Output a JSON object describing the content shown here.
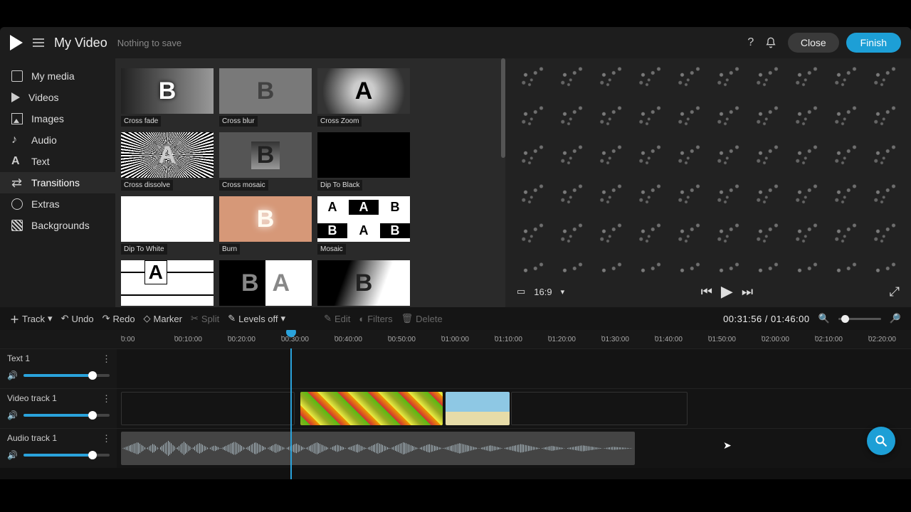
{
  "header": {
    "title": "My Video",
    "save_status": "Nothing to save",
    "close": "Close",
    "finish": "Finish"
  },
  "sidebar": {
    "items": [
      {
        "label": "My media"
      },
      {
        "label": "Videos"
      },
      {
        "label": "Images"
      },
      {
        "label": "Audio"
      },
      {
        "label": "Text"
      },
      {
        "label": "Transitions"
      },
      {
        "label": "Extras"
      },
      {
        "label": "Backgrounds"
      }
    ],
    "active_index": 5
  },
  "transitions": [
    {
      "label": "Cross fade"
    },
    {
      "label": "Cross blur"
    },
    {
      "label": "Cross Zoom"
    },
    {
      "label": "Cross dissolve"
    },
    {
      "label": "Cross mosaic"
    },
    {
      "label": "Dip To Black"
    },
    {
      "label": "Dip To White"
    },
    {
      "label": "Burn"
    },
    {
      "label": "Mosaic"
    }
  ],
  "preview": {
    "aspect": "16:9"
  },
  "toolbar": {
    "track": "Track",
    "undo": "Undo",
    "redo": "Redo",
    "marker": "Marker",
    "split": "Split",
    "levels": "Levels off",
    "edit": "Edit",
    "filters": "Filters",
    "delete": "Delete",
    "timecode": "00:31:56 / 01:46:00"
  },
  "ruler": [
    "0:00",
    "00:10:00",
    "00:20:00",
    "00:30:00",
    "00:40:00",
    "00:50:00",
    "01:00:00",
    "01:10:00",
    "01:20:00",
    "01:30:00",
    "01:40:00",
    "01:50:00",
    "02:00:00",
    "02:10:00",
    "02:20:00"
  ],
  "tracks": {
    "text": "Text 1",
    "video": "Video track 1",
    "audio": "Audio track 1"
  },
  "colors": {
    "accent": "#1d9fd6"
  }
}
